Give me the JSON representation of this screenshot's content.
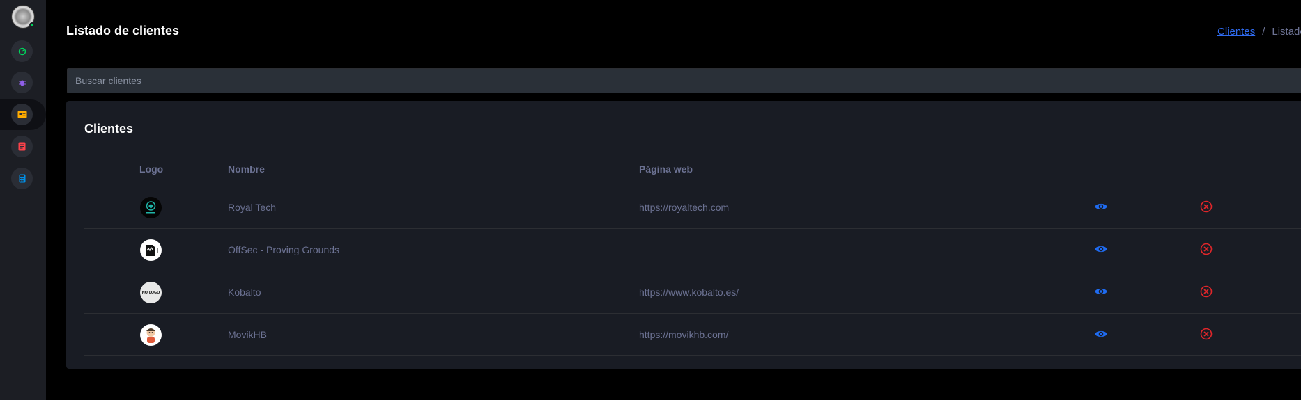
{
  "header": {
    "title": "Listado de clientes",
    "breadcrumb": {
      "link": "Clientes",
      "separator": "/",
      "current": "Listado"
    }
  },
  "search": {
    "placeholder": "Buscar clientes"
  },
  "sidebar": {
    "items": [
      {
        "icon": "speedometer-icon",
        "color": "#00d25b"
      },
      {
        "icon": "bug-icon",
        "color": "#8f5fe8"
      },
      {
        "icon": "contact-card-icon",
        "color": "#ffab00",
        "active": true
      },
      {
        "icon": "document-icon",
        "color": "#fc424a"
      },
      {
        "icon": "calculator-icon",
        "color": "#0090e7"
      }
    ]
  },
  "card": {
    "title": "Clientes",
    "columns": [
      "Logo",
      "Nombre",
      "Página web"
    ],
    "rows": [
      {
        "logo": "royal-tech-logo",
        "name": "Royal Tech",
        "website": "https://royaltech.com"
      },
      {
        "logo": "offsec-logo",
        "name": "OffSec - Proving Grounds",
        "website": ""
      },
      {
        "logo": "no-logo-placeholder",
        "logo_text": "NO LOGO",
        "name": "Kobalto",
        "website": "https://www.kobalto.es/"
      },
      {
        "logo": "movikhb-logo",
        "name": "MovikHB",
        "website": "https://movikhb.com/"
      }
    ]
  },
  "colors": {
    "view_action": "#1f6bf0",
    "delete_action": "#e0262a",
    "text_muted": "#6c7293",
    "card_bg": "#191c24"
  }
}
